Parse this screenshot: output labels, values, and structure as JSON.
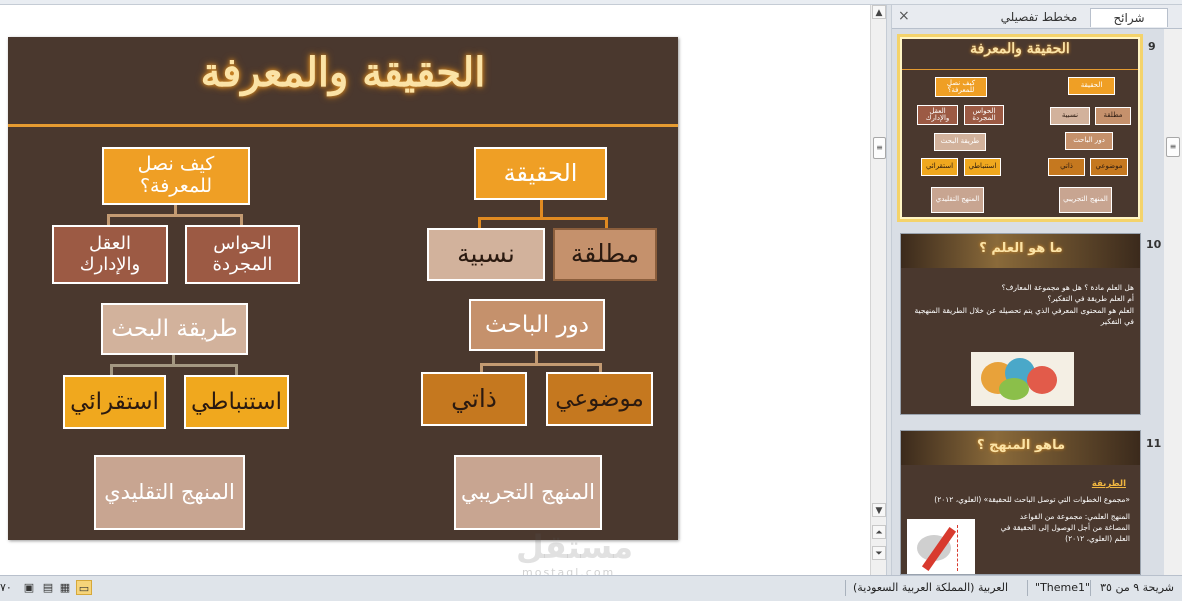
{
  "main_slide": {
    "title": "الحقيقة والمعرفة",
    "truth": {
      "label": "الحقيقة",
      "children": [
        "مطلقة",
        "نسبية"
      ]
    },
    "researcher_role": {
      "label": "دور الباحث",
      "children": [
        "موضوعي",
        "ذاتي"
      ]
    },
    "experimental": "المنهج التجريبي",
    "knowledge": {
      "label": "كيف نصل للمعرفة؟",
      "children": [
        "الحواس المجردة",
        "العقل والإدارك"
      ]
    },
    "research_method": {
      "label": "طريقة البحث",
      "children": [
        "استنباطي",
        "استقرائي"
      ]
    },
    "traditional": "المنهج التقليدي"
  },
  "slide_panel": {
    "tabs": {
      "slides": "شرائح",
      "outline": "مخطط تفصيلي",
      "close": "×"
    },
    "thumbnails": [
      {
        "number": "9",
        "title": "الحقيقة والمعرفة",
        "items": [
          "الحقيقة",
          "مطلقة",
          "نسبية",
          "دور الباحث",
          "موضوعي",
          "ذاتي",
          "المنهج التجريبي",
          "كيف نصل للمعرفة؟",
          "الحواس المجردة",
          "العقل والإدارك",
          "طريقة البحث",
          "استنباطي",
          "استقرائي",
          "المنهج التقليدي"
        ]
      },
      {
        "number": "10",
        "title": "ما هو العلم ؟",
        "bullets": [
          "هل العلم مادة ؟ هل هو مجموعة المعارف؟",
          "أم العلم طريقة في التفكير؟",
          "العلم هو المحتوى المعرفي الذي يتم تحصيله عن خلال الطريقة المنهجية في التفكير"
        ]
      },
      {
        "number": "11",
        "title": "ماهو المنهج ؟",
        "heading": "الطريقة",
        "bullets": [
          "«مجموع الخطوات التي توصل الباحث للحقيقة» (العلوي، ٢٠١٢)",
          "المنهج العلمي: مجموعة من القواعد المصاغة من أجل الوصول إلى الحقيقة في العلم (العلوي، ٢٠١٢)"
        ]
      }
    ]
  },
  "status_bar": {
    "slide_info": "شريحة ٩ من ٣٥",
    "theme": "\"Theme1\"",
    "language": "العربية (المملكة العربية السعودية)",
    "zoom_fragment": "٧٠"
  },
  "watermark": {
    "text": "مستقل",
    "sub": "mostaql.com"
  },
  "colors": {
    "slide_bg": "#4a382e",
    "accent": "#ef9f25",
    "title_glow": "#fbe3a6"
  }
}
